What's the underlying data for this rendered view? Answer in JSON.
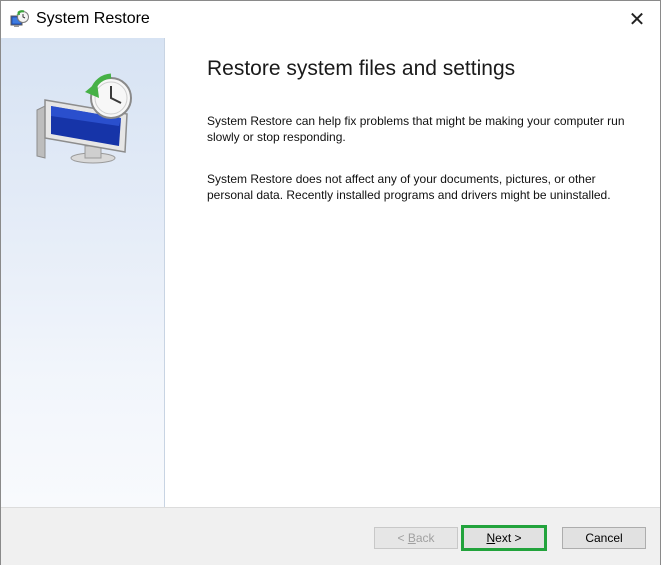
{
  "window": {
    "title": "System Restore",
    "icon": "system-restore-icon",
    "close_glyph": "✕"
  },
  "sidebar": {
    "illustration": "monitor-clock-restore-icon"
  },
  "main": {
    "heading": "Restore system files and settings",
    "paragraph1": "System Restore can help fix problems that might be making your computer run slowly or stop responding.",
    "paragraph2": "System Restore does not affect any of your documents, pictures, or other personal data. Recently installed programs and drivers might be uninstalled."
  },
  "footer": {
    "back_label": "< Back",
    "back_mnemonic": "B",
    "next_label": "Next >",
    "next_mnemonic": "N",
    "cancel_label": "Cancel",
    "back_enabled": false,
    "next_highlight_color": "#22a33c"
  }
}
